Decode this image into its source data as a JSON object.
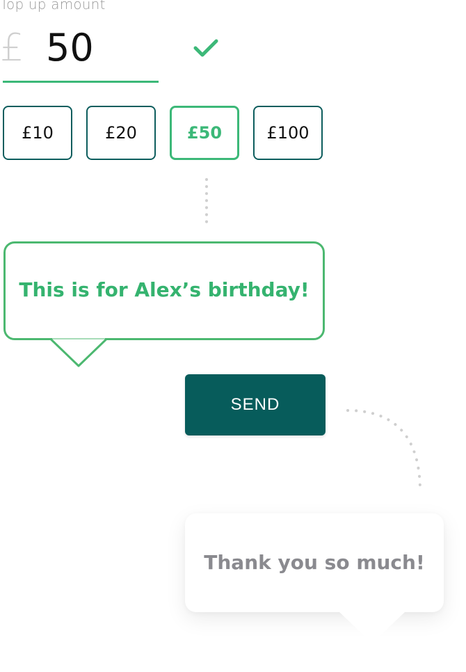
{
  "topup": {
    "label": "Top up amount",
    "currency_symbol": "£",
    "amount": "50"
  },
  "presets": [
    {
      "label": "£10",
      "selected": false
    },
    {
      "label": "£20",
      "selected": false
    },
    {
      "label": "£50",
      "selected": true
    },
    {
      "label": "£100",
      "selected": false
    }
  ],
  "message": {
    "text": "This is for Alex’s birthday!"
  },
  "actions": {
    "send_label": "SEND"
  },
  "reply": {
    "text": "Thank you so much!"
  },
  "colors": {
    "accent_green": "#3cb878",
    "dark_teal": "#075c5b",
    "reply_text": "#8a8a8f"
  }
}
